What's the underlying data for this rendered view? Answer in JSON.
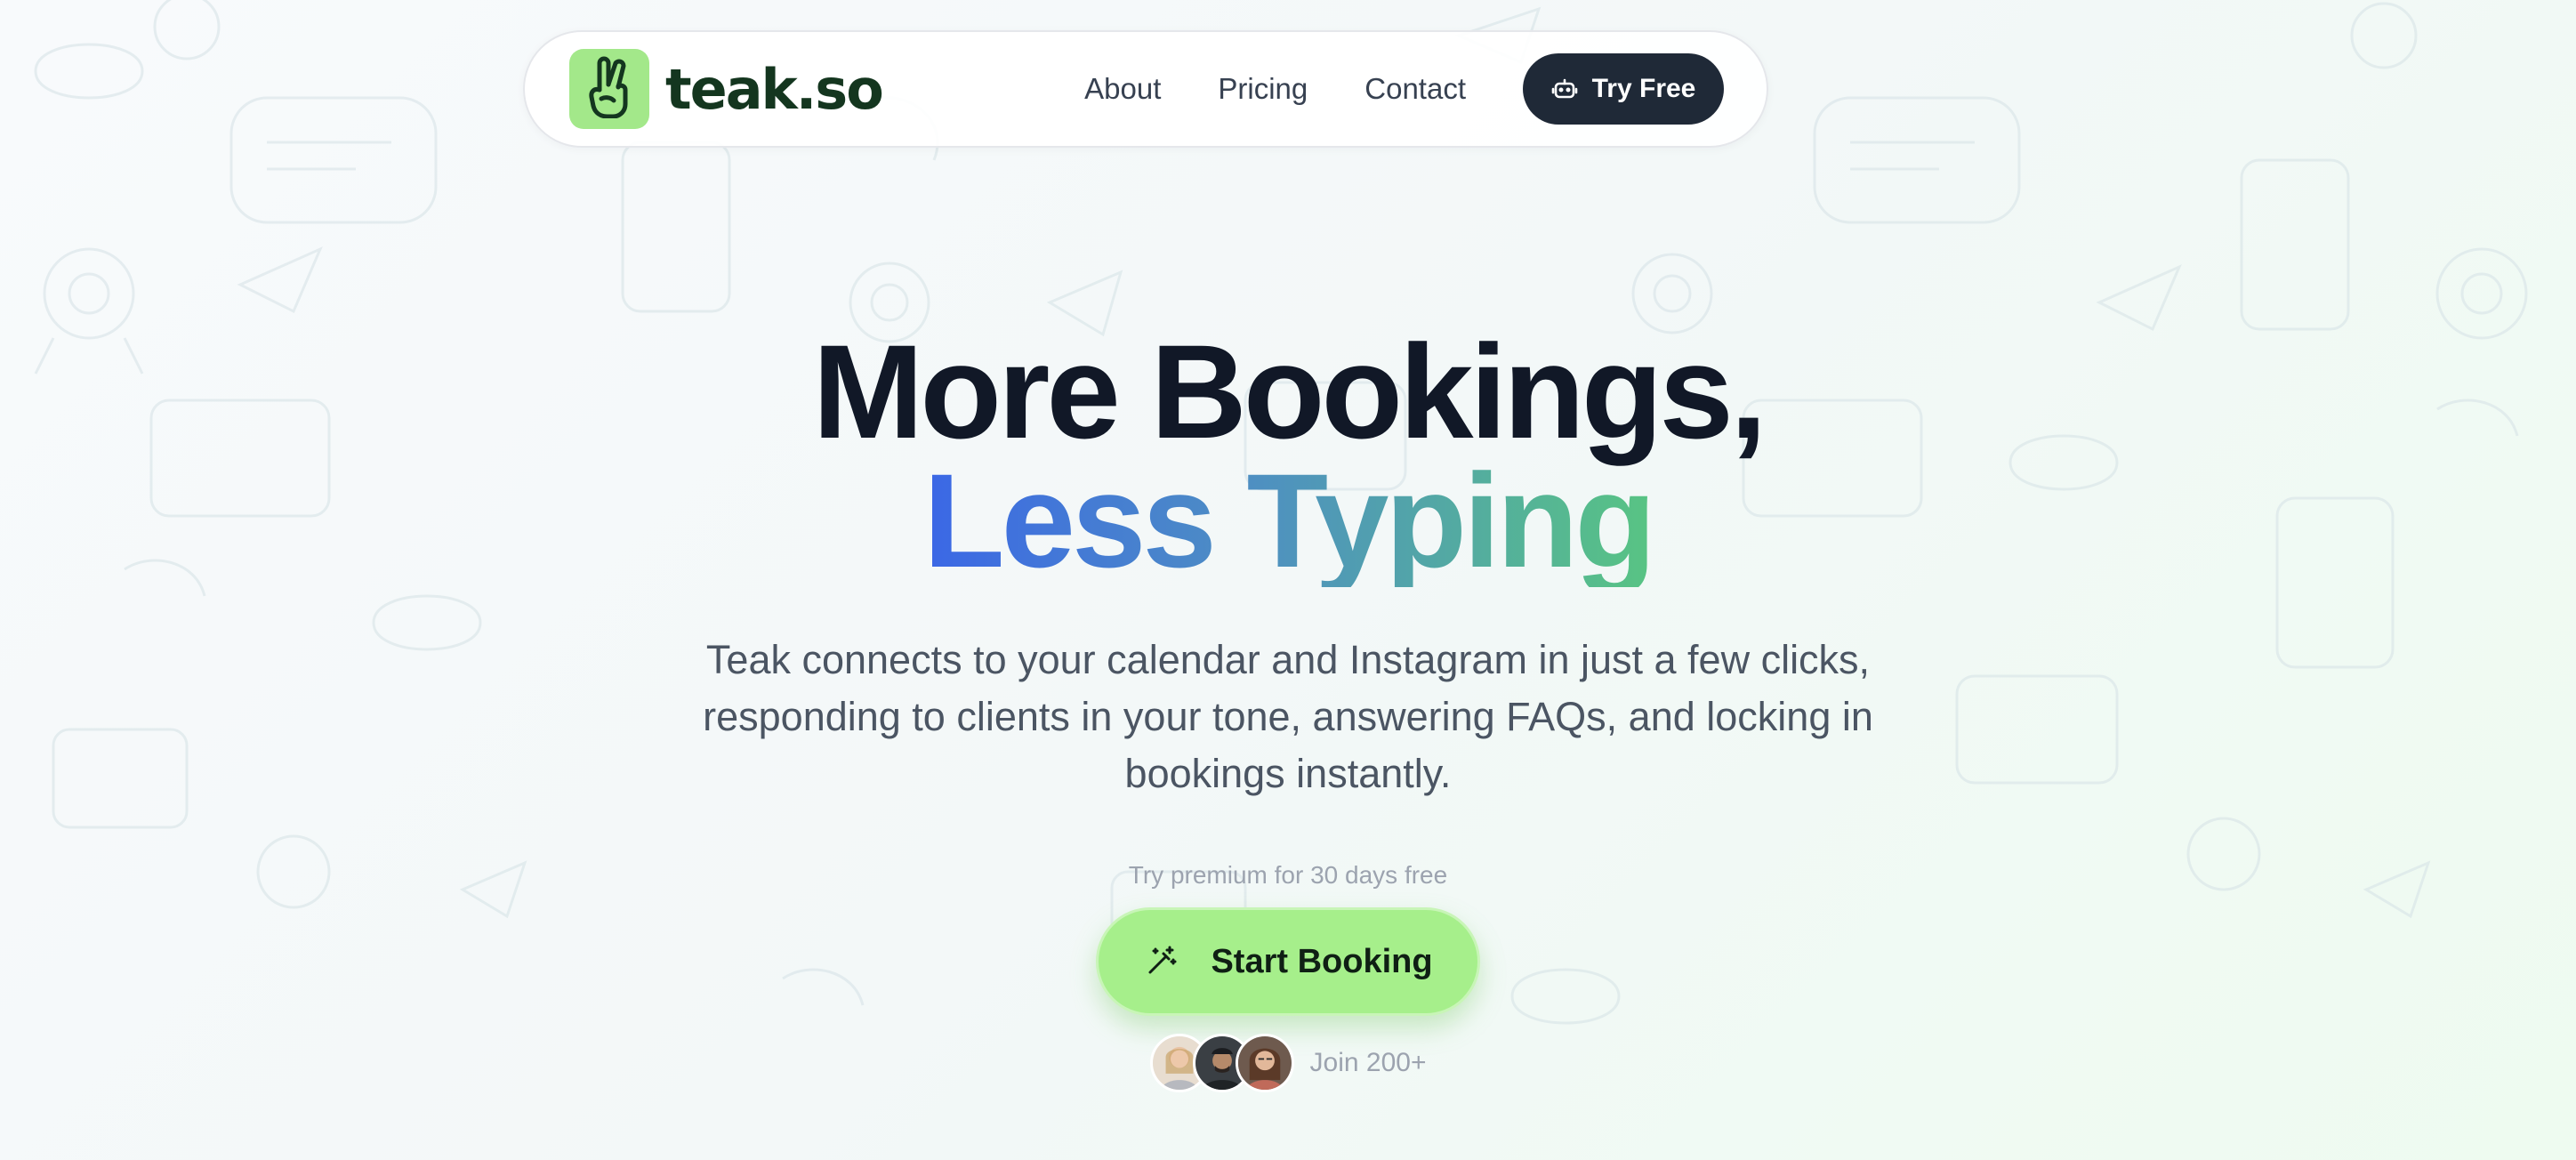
{
  "brand": {
    "name": "teak.so",
    "logo_icon": "peace-hand-icon",
    "logo_bg": "#a3e88a"
  },
  "nav": {
    "links": [
      "About",
      "Pricing",
      "Contact"
    ],
    "cta_label": "Try Free",
    "cta_icon": "robot-icon"
  },
  "hero": {
    "title_line1": "More Bookings,",
    "title_line2": "Less Typing",
    "subtitle": "Teak connects to your calendar and Instagram in just a few clicks, responding to clients in your tone, answering FAQs, and locking in bookings instantly.",
    "premium_note": "Try premium for 30 days free",
    "cta_label": "Start Booking",
    "cta_icon": "magic-wand-icon",
    "social_proof": "Join 200+"
  },
  "colors": {
    "accent_green": "#a6ef8b",
    "dark_button": "#1f2937",
    "gradient_start": "#3b67e6",
    "gradient_end": "#58c483"
  }
}
